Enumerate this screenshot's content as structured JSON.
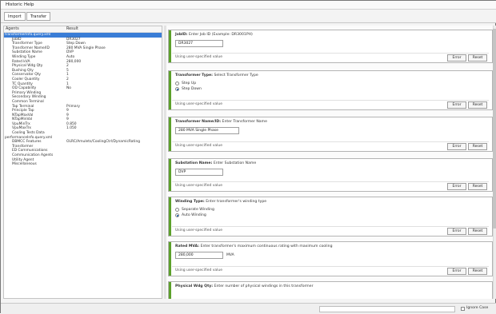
{
  "menu": {
    "items": [
      "Historic",
      "Help"
    ]
  },
  "toolbar": {
    "tabs": [
      "Import",
      "Transfer"
    ]
  },
  "tree": {
    "header_labels": [
      "Agents",
      "Result"
    ],
    "rows": [
      {
        "key": "transformerInfo.query.xml",
        "value": "",
        "level": "parent",
        "selected": true
      },
      {
        "key": "JobID",
        "value": "DR3027"
      },
      {
        "key": "Transformer Type",
        "value": "Step Down"
      },
      {
        "key": "Transformer Name/ID",
        "value": "280 MVA Single Phase"
      },
      {
        "key": "Substation Name",
        "value": "DVP"
      },
      {
        "key": "Winding Type",
        "value": "Auto"
      },
      {
        "key": "Rated kVA",
        "value": "280,000"
      },
      {
        "key": "Physical Wdg Qty",
        "value": "2"
      },
      {
        "key": "Bushing Qty",
        "value": "5"
      },
      {
        "key": "Conservator Qty",
        "value": "1"
      },
      {
        "key": "Cooler Quantity",
        "value": "2"
      },
      {
        "key": "TC Quantity",
        "value": "1"
      },
      {
        "key": "OD Capability",
        "value": "No"
      },
      {
        "key": "Primary Winding",
        "value": ""
      },
      {
        "key": "Secondary Winding",
        "value": ""
      },
      {
        "key": "Common Terminal",
        "value": ""
      },
      {
        "key": "Tap Terminal",
        "value": "Primary"
      },
      {
        "key": "Principle Tap",
        "value": "9"
      },
      {
        "key": "NTapMaxVal",
        "value": "9"
      },
      {
        "key": "NTapMinVal",
        "value": "9"
      },
      {
        "key": "VpuMinTrx",
        "value": "0.850"
      },
      {
        "key": "VpuMaxTrx",
        "value": "1.050"
      },
      {
        "key": "Cooling Tests Data",
        "value": ""
      },
      {
        "key": "performanceInfo.query.xml",
        "value": "",
        "level": "parent"
      },
      {
        "key": "DBMCC Features",
        "value": "OLRC/Amulets/CoolingCtrl/DynamicRating"
      },
      {
        "key": "Transformer",
        "value": ""
      },
      {
        "key": "ED Communications",
        "value": ""
      },
      {
        "key": "Communication Agents",
        "value": ""
      },
      {
        "key": "Utility Agent",
        "value": ""
      },
      {
        "key": "Miscellaneous",
        "value": ""
      }
    ]
  },
  "cards": {
    "note": "Using user-specified value",
    "error_label": "Error",
    "reset_label": "Reset",
    "c1": {
      "name": "JobID:",
      "desc": "Enter Job ID (Example: DR3001PH)",
      "value": "DR3027"
    },
    "c2": {
      "name": "Transformer Type:",
      "desc": "Select Transformer Type",
      "options": [
        "Step Up",
        "Step Down"
      ],
      "selected": 1
    },
    "c3": {
      "name": "Transformer Name/ID:",
      "desc": "Enter Transformer Name",
      "value": "280 MVA Single Phase"
    },
    "c4": {
      "name": "Substation Name:",
      "desc": "Enter Substation Name",
      "value": "DVP"
    },
    "c5": {
      "name": "Winding Type:",
      "desc": "Enter transformer's winding type",
      "options": [
        "Separate Winding",
        "Auto Winding"
      ],
      "selected": 1
    },
    "c6": {
      "name": "Rated MVA:",
      "desc": "Enter transformer's maximum continuous rating with maximum cooling",
      "value": "280,000",
      "unit": "MVA"
    },
    "c7": {
      "name": "Physical Wdg Qty:",
      "desc": "Enter number of physical windings in this transformer"
    }
  },
  "status": {
    "checkbox_label": "Ignore Case"
  }
}
